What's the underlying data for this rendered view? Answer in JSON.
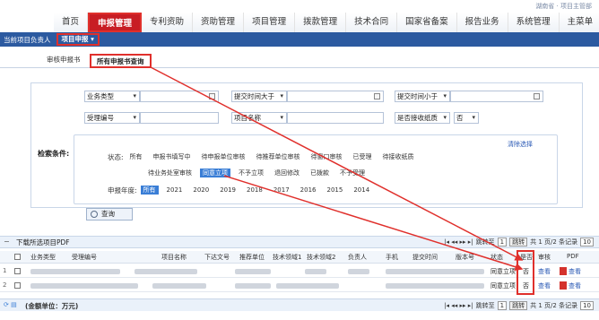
{
  "header": {
    "status": "湖南省 · 项目主管部"
  },
  "nav": {
    "items": [
      "首页",
      "申报管理",
      "专利资助",
      "资助管理",
      "项目管理",
      "拨款管理",
      "技术合同",
      "国家省备案",
      "报告业务",
      "系统管理",
      "主菜单"
    ],
    "active_index": 1
  },
  "subnav": {
    "prefix": "当前项目负责人",
    "current": "项目申报 ▾"
  },
  "tabs": [
    "审核申报书",
    "所有申报书查询"
  ],
  "search": {
    "fields": {
      "type_label": "业务类型",
      "time_gt_label": "提交时间大于",
      "time_lt_label": "提交时间小于",
      "accept_label": "受理编号",
      "name_label": "项目名称",
      "paper_label": "是否接收纸质",
      "paper_value": "否"
    },
    "condition_label": "检索条件:",
    "clear_label": "清除选择",
    "status_label": "状态:",
    "status_row1": [
      "所有",
      "申报书填写中",
      "待申报单位审核",
      "待推荐单位审核",
      "待窗口审核",
      "已受理",
      "待接收纸质"
    ],
    "status_row2": [
      "待业务处室审核",
      "同意立项",
      "不予立项",
      "退回修改",
      "已拨款",
      "不予受理"
    ],
    "status_active": "同意立项",
    "year_label": "申报年度:",
    "years": [
      "所有",
      "2021",
      "2020",
      "2019",
      "2018",
      "2017",
      "2016",
      "2015",
      "2014"
    ],
    "query_label": "查询"
  },
  "grid": {
    "download_label": "下载所选项目PDF",
    "pager": {
      "goto": "跳转至",
      "page": "1",
      "go": "跳转",
      "total": "共 1 页/2 条记录",
      "size": "10"
    },
    "columns": [
      "业务类型",
      "受理编号",
      "项目名称",
      "下达文号",
      "推荐单位",
      "技术领域1",
      "技术领域2",
      "负责人",
      "手机",
      "提交时间",
      "版本号",
      "状态",
      "是否",
      "审核",
      "PDF"
    ],
    "rows": [
      {
        "num": "1",
        "status": "同意立项",
        "flag": "否",
        "audit": "查看",
        "pdf": "查看"
      },
      {
        "num": "2",
        "status": "同意立项",
        "flag": "否",
        "audit": "查看",
        "pdf": "查看"
      }
    ],
    "footer_label": "(金额单位：万元)",
    "footer_pager": {
      "goto": "跳转至",
      "page": "1",
      "go": "跳转",
      "total": "共 1 页/2 条记录",
      "size": "10"
    }
  },
  "colors": {
    "accent_red": "#e0302c",
    "nav_blue": "#2c5aa0"
  }
}
